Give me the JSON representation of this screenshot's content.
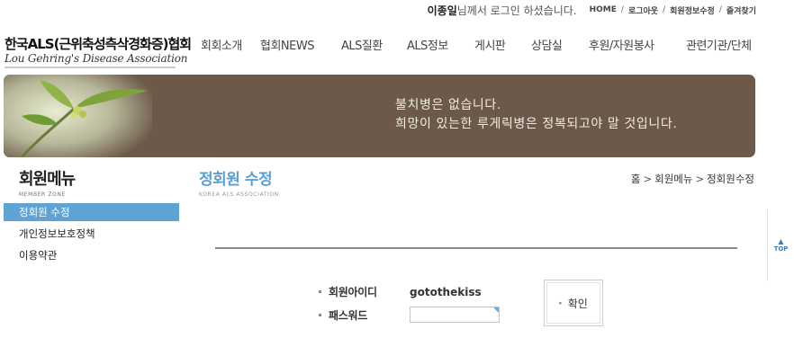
{
  "header": {
    "user_name": "이종일",
    "login_message": "님께서 로그인 하셨습니다.",
    "links": [
      "HOME",
      "로그아웃",
      "회원정보수정",
      "즐겨찾기"
    ],
    "separator": "/"
  },
  "logo": {
    "korean": "한국ALS(근위축성측삭경화증)협회",
    "english": "Lou Gehring's Disease Association"
  },
  "nav": {
    "items": [
      "회회소개",
      "협회NEWS",
      "ALS질환",
      "ALS정보",
      "게시판",
      "상담실",
      "후원/자원봉사",
      "관련기관/단체"
    ]
  },
  "banner": {
    "line1": "불치병은 없습니다.",
    "line2": "희망이 있는한 루게릭병은 정복되고야 말 것입니다."
  },
  "sidebar": {
    "title": "회원메뉴",
    "subtitle": "MEMBER ZONE",
    "items": [
      {
        "label": "정회원 수정",
        "active": true
      },
      {
        "label": "개인정보보호정책",
        "active": false
      },
      {
        "label": "이용약관",
        "active": false
      }
    ]
  },
  "content": {
    "title": "정회원 수정",
    "subtitle": "KOREA ALS ASSOCIATION",
    "breadcrumb": [
      "홈",
      "회원메뉴",
      "정회원수정"
    ],
    "breadcrumb_sep": ">"
  },
  "form": {
    "id_label": "회원아이디",
    "id_value": "gotothekiss",
    "pw_label": "패스워드",
    "pw_value": "",
    "confirm_label": "확인"
  },
  "top_button": {
    "label": "TOP"
  },
  "colors": {
    "accent": "#5b9fd0",
    "sidebar_active": "#5fa2d4",
    "banner_bg": "#6c5949"
  }
}
